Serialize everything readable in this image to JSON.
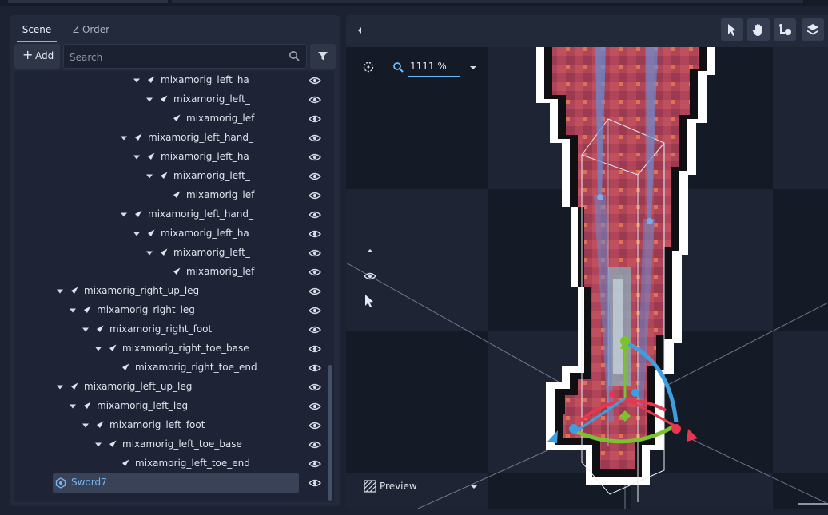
{
  "scene_panel": {
    "tabs": [
      {
        "label": "Scene"
      },
      {
        "label": "Z Order"
      }
    ],
    "add_button": "Add",
    "search_placeholder": "Search",
    "tree": [
      {
        "label": "mixamorig_left_ha",
        "level": 8,
        "expanded": true
      },
      {
        "label": "mixamorig_left_",
        "level": 9,
        "expanded": true
      },
      {
        "label": "mixamorig_lef",
        "level": 10,
        "expanded": false
      },
      {
        "label": "mixamorig_left_hand_",
        "level": 7,
        "expanded": true
      },
      {
        "label": "mixamorig_left_ha",
        "level": 8,
        "expanded": true
      },
      {
        "label": "mixamorig_left_",
        "level": 9,
        "expanded": true
      },
      {
        "label": "mixamorig_lef",
        "level": 10,
        "expanded": false
      },
      {
        "label": "mixamorig_left_hand_",
        "level": 7,
        "expanded": true
      },
      {
        "label": "mixamorig_left_ha",
        "level": 8,
        "expanded": true
      },
      {
        "label": "mixamorig_left_",
        "level": 9,
        "expanded": true
      },
      {
        "label": "mixamorig_lef",
        "level": 10,
        "expanded": false
      },
      {
        "label": "mixamorig_right_up_leg",
        "level": 2,
        "expanded": true
      },
      {
        "label": "mixamorig_right_leg",
        "level": 3,
        "expanded": true
      },
      {
        "label": "mixamorig_right_foot",
        "level": 4,
        "expanded": true
      },
      {
        "label": "mixamorig_right_toe_base",
        "level": 5,
        "expanded": true
      },
      {
        "label": "mixamorig_right_toe_end",
        "level": 6,
        "expanded": false
      },
      {
        "label": "mixamorig_left_up_leg",
        "level": 2,
        "expanded": true
      },
      {
        "label": "mixamorig_left_leg",
        "level": 3,
        "expanded": true
      },
      {
        "label": "mixamorig_left_foot",
        "level": 4,
        "expanded": true
      },
      {
        "label": "mixamorig_left_toe_base",
        "level": 5,
        "expanded": true
      },
      {
        "label": "mixamorig_left_toe_end",
        "level": 6,
        "expanded": false
      },
      {
        "label": "Sword7",
        "level": 1,
        "expanded": false,
        "selected": true,
        "node_icon": "sprite-node-icon"
      }
    ]
  },
  "viewport": {
    "zoom": "1111 %",
    "preview_label": "Preview",
    "tools": [
      {
        "icon": "select-arrow-icon"
      },
      {
        "icon": "pan-hand-icon"
      },
      {
        "icon": "bone-pose-icon"
      },
      {
        "icon": "layers-icon"
      }
    ],
    "colors": {
      "accent": "#70bafa",
      "gizmo_x": "#e8364f",
      "gizmo_y": "#7ac22f",
      "gizmo_z": "#3f9ee0"
    }
  }
}
